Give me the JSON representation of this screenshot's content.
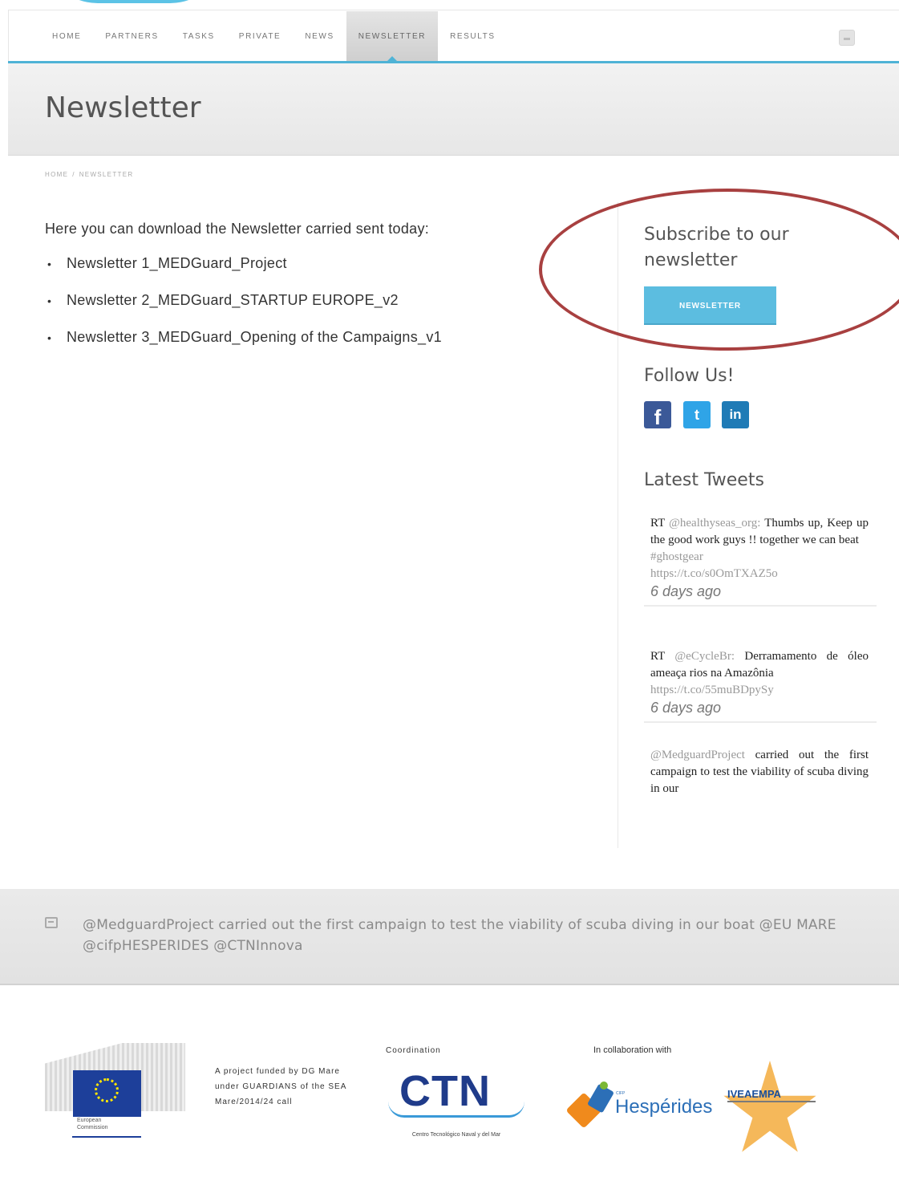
{
  "nav": {
    "items": [
      {
        "label": "HOME",
        "active": false
      },
      {
        "label": "PARTNERS",
        "active": false
      },
      {
        "label": "TASKS",
        "active": false
      },
      {
        "label": "PRIVATE",
        "active": false
      },
      {
        "label": "NEWS",
        "active": false
      },
      {
        "label": "NEWSLETTER",
        "active": true
      },
      {
        "label": "RESULTS",
        "active": false
      }
    ],
    "search_icon": "search-icon"
  },
  "page": {
    "title": "Newsletter",
    "breadcrumb": [
      "HOME",
      "/",
      "NEWSLETTER"
    ]
  },
  "main": {
    "intro": "Here you can download the Newsletter carried sent today:",
    "newsletters": [
      "Newsletter 1_MEDGuard_Project",
      "Newsletter 2_MEDGuard_STARTUP EUROPE_v2",
      "Newsletter 3_MEDGuard_Opening of the Campaigns_v1"
    ]
  },
  "sidebar": {
    "subscribe_heading": "Subscribe to our newsletter",
    "newsletter_button": "NEWSLETTER",
    "follow_heading": "Follow Us!",
    "social": [
      {
        "icon": "facebook-icon",
        "glyph": "f"
      },
      {
        "icon": "twitter-icon",
        "glyph": "t"
      },
      {
        "icon": "linkedin-icon",
        "glyph": "in"
      }
    ],
    "tweets_heading": "Latest Tweets",
    "tweets": [
      {
        "prefix": "RT",
        "handle": "@healthyseas_org:",
        "text": "Thumbs up, Keep up the good work guys !! together we can beat",
        "hashtag": "#ghostgear",
        "link": "https://t.co/s0OmTXAZ5o",
        "ago": "6 days ago"
      },
      {
        "prefix": "RT",
        "handle": "@eCycleBr:",
        "text": "Derramamento de óleo ameaça rios na Amazônia",
        "link": "https://t.co/55muBDpySy",
        "ago": "6 days ago"
      },
      {
        "handle": "@MedguardProject",
        "text": "carried out the first campaign to test the viability of scuba diving in our"
      }
    ]
  },
  "tweet_band": {
    "text": "@MedguardProject carried out the first campaign to test the viability of scuba diving in our boat @EU MARE @cifpHESPERIDES @CTNInnova"
  },
  "footer": {
    "eu_label": "European Commission",
    "funded_text": "A project funded by DG Mare under GUARDIANS of the SEA Mare/2014/24 call",
    "coordination_label": "Coordination",
    "ctn_logo_text": "CTN",
    "ctn_subtitle": "Centro Tecnológico Naval y del Mar",
    "collaboration_label": "In collaboration with",
    "hesperides_text": "Hespérides",
    "hesperides_small": "CIFP",
    "ivea_text": "IVEAEMPA"
  }
}
